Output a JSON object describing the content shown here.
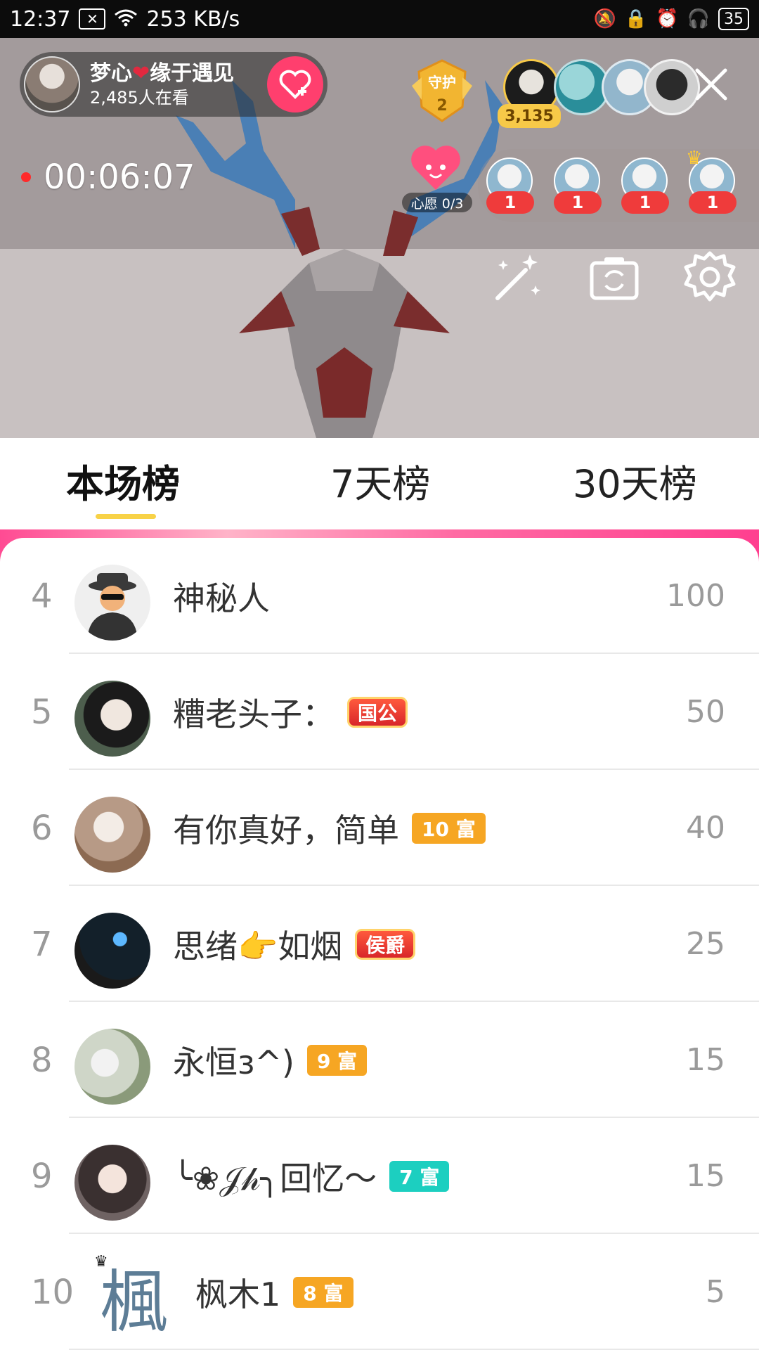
{
  "status_bar": {
    "time": "12:37",
    "net_speed": "253 KB/s",
    "battery": "35"
  },
  "live": {
    "host_name": "梦心",
    "host_name_suffix": "缘于遇见",
    "viewers": "2,485人在看",
    "guard_label": "守护",
    "guard_count": "2",
    "viewer_count": "3,135",
    "timer": "00:06:07",
    "wish_label": "心愿 0/3",
    "gift_counts": [
      "1",
      "1",
      "1",
      "1"
    ]
  },
  "tabs": [
    {
      "label": "本场榜"
    },
    {
      "label": "7天榜"
    },
    {
      "label": "30天榜"
    }
  ],
  "ranking": [
    {
      "rank": "4",
      "name": "神秘人",
      "badge": "",
      "score": "100"
    },
    {
      "rank": "5",
      "name": "糟老头子：",
      "badge": "国公",
      "score": "50"
    },
    {
      "rank": "6",
      "name": "有你真好，简单",
      "badge": "10 富",
      "score": "40"
    },
    {
      "rank": "7",
      "name": "思绪👉如烟",
      "badge": "侯爵",
      "score": "25"
    },
    {
      "rank": "8",
      "name": "永恒ɜ^)",
      "badge": "9 富",
      "score": "15"
    },
    {
      "rank": "9",
      "name": "╰❀𝒥𝒽╮回忆～",
      "badge": "7 富",
      "score": "15"
    },
    {
      "rank": "10",
      "name": "枫木1",
      "badge": "8 富",
      "score": "5"
    }
  ],
  "avatar_10_glyph": "楓"
}
